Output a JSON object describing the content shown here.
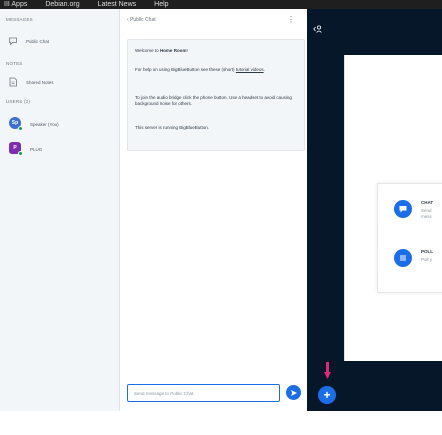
{
  "browser_bar": {
    "items": [
      "III Apps",
      "Debian.org",
      "Latest News",
      "Help"
    ]
  },
  "sidebar": {
    "messages_title": "MESSAGES",
    "public_chat_label": "Public Chat",
    "notes_title": "NOTES",
    "shared_notes_label": "Shared Notes",
    "users_title": "USERS (2)",
    "users": [
      {
        "initials": "Sp",
        "name": "Speaker (You)",
        "color": "#3d6fcf"
      },
      {
        "initials": "P",
        "name": "PLUG",
        "color": "#7b2fb0"
      }
    ]
  },
  "chat": {
    "back_label": "Public Chat",
    "kebab": "⋮",
    "welcome_prefix": "Welcome to ",
    "welcome_room": "Home Room",
    "welcome_suffix": "!",
    "help_prefix": "For help on using BigBlueButton see these (short) ",
    "help_link": "tutorial videos",
    "help_suffix": ".",
    "audio_text": "To join the audio bridge click the phone button. Use a headset to avoid causing background noise for others.",
    "server_text": "This server is running BigBlueButton.",
    "input_placeholder": "Send message to Public Chat"
  },
  "stage": {
    "cards": [
      {
        "title": "CHAT",
        "subtitle_line1": "Send",
        "subtitle_line2": "mess",
        "icon": "chat-bubble-icon"
      },
      {
        "title": "POLL",
        "subtitle_line1": "Poll y",
        "subtitle_line2": "",
        "icon": "poll-list-icon"
      }
    ],
    "add_label": "+"
  },
  "colors": {
    "accent": "#1c6ee8",
    "stage_bg": "#06172a",
    "arrow": "#e0287a",
    "sidebar_bg": "#f3f6f9"
  }
}
